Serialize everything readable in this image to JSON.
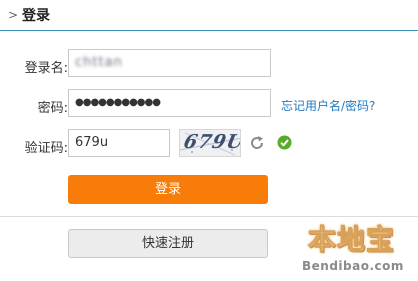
{
  "header": {
    "chevron": ">",
    "title": "登录"
  },
  "form": {
    "username": {
      "label": "登录名:",
      "value": "chttan"
    },
    "password": {
      "label": "密码:",
      "value": "●●●●●●●●●●●",
      "forgot_link": "忘记用户名/密码?"
    },
    "captcha": {
      "label": "验证码:",
      "value": "679u",
      "image_text": "679U"
    }
  },
  "buttons": {
    "login": "登录",
    "register": "快速注册"
  },
  "watermark": {
    "brand": "本地宝",
    "url": "Bendibao.com"
  },
  "colors": {
    "accent_orange": "#f77c0a",
    "header_line": "#3a8fb7",
    "link_blue": "#1f7bc4",
    "valid_green": "#5aab2b"
  },
  "icons": {
    "refresh": "refresh-icon",
    "valid": "check-circle-icon"
  }
}
